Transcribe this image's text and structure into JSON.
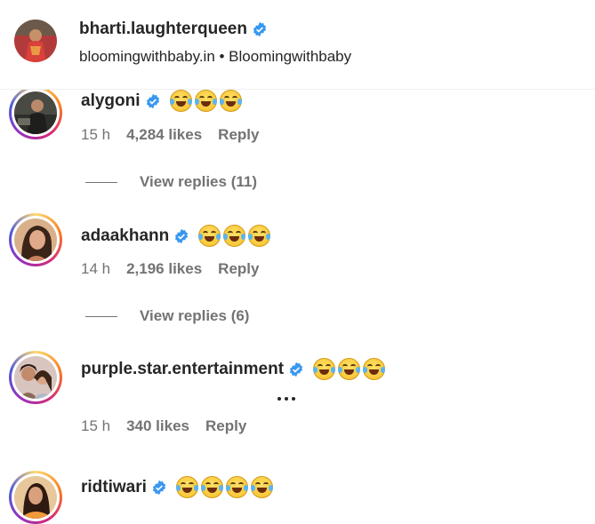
{
  "post_header": {
    "username": "bharti.laughterqueen",
    "subtitle": "bloomingwithbaby.in • Bloomingwithbaby",
    "verified_icon": "verified-badge-icon",
    "accent_color": "#3897f0"
  },
  "comments": [
    {
      "username": "alygoni",
      "emoji_count": 3,
      "time": "15 h",
      "likes": "4,284 likes",
      "reply": "Reply",
      "view_replies": "View replies (11)"
    },
    {
      "username": "adaakhann",
      "emoji_count": 3,
      "time": "14 h",
      "likes": "2,196 likes",
      "reply": "Reply",
      "view_replies": "View replies (6)"
    },
    {
      "username": "purple.star.entertainment",
      "emoji_count": 3,
      "time": "15 h",
      "likes": "340 likes",
      "reply": "Reply"
    },
    {
      "username": "ridtiwari",
      "emoji_count": 4
    }
  ]
}
